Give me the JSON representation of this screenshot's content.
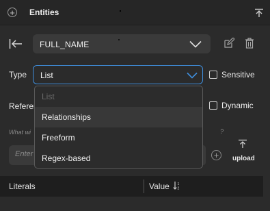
{
  "header": {
    "title": "Entities"
  },
  "entity": {
    "name": "FULL_NAME"
  },
  "type_field": {
    "label": "Type",
    "value": "List",
    "options": [
      "List",
      "Relationships",
      "Freeform",
      "Regex-based"
    ]
  },
  "sensitive": {
    "label": "Sensitive",
    "checked": false
  },
  "reference": {
    "label_partial": "Referen"
  },
  "dynamic": {
    "label": "Dynamic",
    "checked": false
  },
  "hint": {
    "left_partial": "What wi",
    "right_partial": "?"
  },
  "value_input": {
    "placeholder": "Enter"
  },
  "upload": {
    "label": "upload"
  },
  "table": {
    "columns": [
      "Literals",
      "Value"
    ]
  },
  "colors": {
    "accent": "#3f8fde",
    "background": "#2b2b2b",
    "header": "#262626"
  }
}
